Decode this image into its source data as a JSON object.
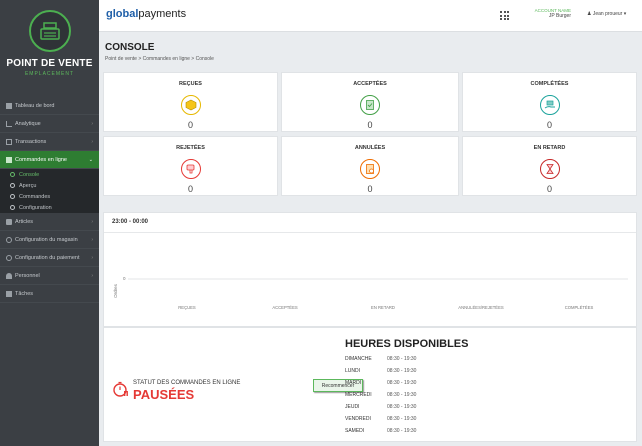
{
  "sidebar": {
    "brand": "POINT DE VENTE",
    "brand_sub": "EMPLACEMENT",
    "items": [
      {
        "label": "Tableau de bord",
        "icon": "dashboard-icon"
      },
      {
        "label": "Analytique",
        "icon": "chart-icon"
      },
      {
        "label": "Transactions",
        "icon": "transactions-icon"
      },
      {
        "label": "Commandes en ligne",
        "icon": "cart-icon"
      }
    ],
    "subitems": [
      {
        "label": "Console"
      },
      {
        "label": "Aperçu"
      },
      {
        "label": "Commandes"
      },
      {
        "label": "Configuration"
      }
    ],
    "items2": [
      {
        "label": "Articles",
        "icon": "tag-icon"
      },
      {
        "label": "Configuration du magasin",
        "icon": "gear-icon"
      },
      {
        "label": "Configuration du paiement",
        "icon": "gear-icon"
      },
      {
        "label": "Personnel",
        "icon": "people-icon"
      },
      {
        "label": "Tâches",
        "icon": "tasks-icon"
      }
    ]
  },
  "topbar": {
    "logo_bold": "global",
    "logo_rest": "payments",
    "account_label": "ACCOUNT NAME",
    "account_business": "JP Burger",
    "user": "Jean proueur"
  },
  "page": {
    "title": "CONSOLE",
    "breadcrumb": "Point de vente  >  Commandes en ligne  >  Console"
  },
  "stats": [
    {
      "label": "REÇUES",
      "value": "0",
      "color": "#e6b800"
    },
    {
      "label": "ACCEPTÉES",
      "value": "0",
      "color": "#43a047"
    },
    {
      "label": "COMPLÉTÉES",
      "value": "0",
      "color": "#1ba39c"
    },
    {
      "label": "REJETÉES",
      "value": "0",
      "color": "#e53935"
    },
    {
      "label": "ANNULÉES",
      "value": "0",
      "color": "#ef6c00"
    },
    {
      "label": "EN RETARD",
      "value": "0",
      "color": "#c62828"
    }
  ],
  "chart_data": {
    "type": "bar",
    "title": "23:00 - 00:00",
    "ylabel": "Ordres",
    "categories": [
      "REÇUES",
      "ACCEPTÉES",
      "EN RETARD",
      "ANNULÉES/REJETÉES",
      "COMPLÉTÉES"
    ],
    "values": [
      0,
      0,
      0,
      0,
      0
    ],
    "yticks": [
      "0"
    ]
  },
  "status": {
    "label": "STATUT DES COMMANDES EN LIGNE",
    "value": "PAUSÉES",
    "button": "Recommencer"
  },
  "hours": {
    "title": "HEURES DISPONIBLES",
    "rows": [
      {
        "day": "DIMANCHE",
        "time": "08:30 - 19:30"
      },
      {
        "day": "LUNDI",
        "time": "08:30 - 19:30"
      },
      {
        "day": "MARDI",
        "time": "08:30 - 19:30"
      },
      {
        "day": "MERCREDI",
        "time": "08:30 - 19:30"
      },
      {
        "day": "JEUDI",
        "time": "08:30 - 19:30"
      },
      {
        "day": "VENDREDI",
        "time": "08:30 - 19:30"
      },
      {
        "day": "SAMEDI",
        "time": "08:30 - 19:30"
      }
    ]
  }
}
